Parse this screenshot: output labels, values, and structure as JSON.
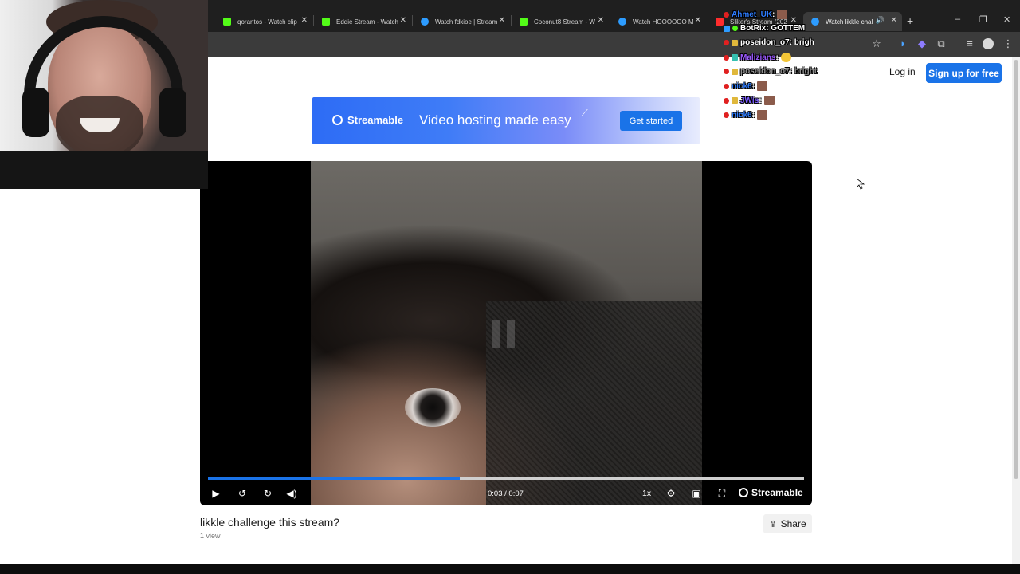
{
  "browser": {
    "tabs": [
      {
        "label": "qorantos - Watch clip",
        "icon_color": "#53fc18"
      },
      {
        "label": "Eddie Stream - Watch",
        "icon_color": "#53fc18"
      },
      {
        "label": "Watch fdkioe | Stream",
        "icon_color": "#2d9cff"
      },
      {
        "label": "Coconut8 Stream - W",
        "icon_color": "#53fc18"
      },
      {
        "label": "Watch HOOOOOO M",
        "icon_color": "#2d9cff"
      },
      {
        "label": "Sliker's Stream (202",
        "icon_color": "#ff2d2d"
      },
      {
        "label": "Watch likkle chal",
        "icon_color": "#2d9cff"
      }
    ],
    "new_tab_symbol": "+",
    "window_controls": [
      "–",
      "❐",
      "✕"
    ]
  },
  "header": {
    "login_label": "Log in",
    "signup_label": "Sign up for free"
  },
  "banner": {
    "brand": "Streamable",
    "tagline": "Video hosting made easy",
    "cta": "Get started"
  },
  "player": {
    "time": "0:03 / 0:07",
    "progress_fraction": 0.422,
    "speed": "1x",
    "brand": "Streamable"
  },
  "video": {
    "title": "likkle challenge this stream?",
    "views": "1 view",
    "share_label": "Share"
  },
  "chat": {
    "messages": [
      {
        "user": "Ahmet_UK",
        "text": ":",
        "color": "#2d7cff",
        "emote": "face"
      },
      {
        "user": "BotRix",
        "text": ": GOTTEM",
        "color": "#ffffff",
        "emote": ""
      },
      {
        "user": "poseidon_o7",
        "text": ": brigh",
        "color": "#ffffff",
        "emote": ""
      },
      {
        "user": "Malizians",
        "text": ":",
        "color": "#9b59ff",
        "emote": "lol"
      },
      {
        "user": "poseidon_o7",
        "text": ": bright",
        "color": "#8d8d8d",
        "emote": ""
      },
      {
        "user": "nick6",
        "text": ":",
        "color": "#2d7cff",
        "emote": "face"
      },
      {
        "user": "JWis",
        "text": ":",
        "color": "#7a5cff",
        "emote": "face"
      },
      {
        "user": "nick6",
        "text": ":",
        "color": "#2d7cff",
        "emote": "face"
      }
    ]
  },
  "colors": {
    "accent": "#1a73e8",
    "chrome_dark": "#1f1f1f",
    "chrome_toolbar": "#3b3b3b"
  }
}
